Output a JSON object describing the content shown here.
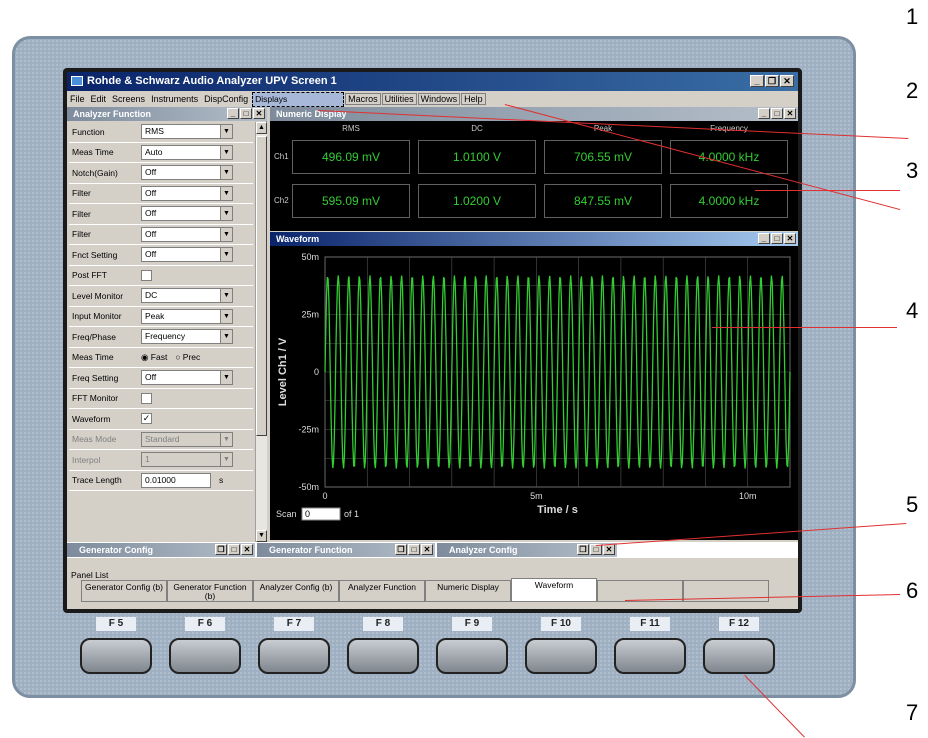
{
  "window": {
    "title": "Rohde & Schwarz Audio Analyzer UPV Screen 1"
  },
  "menu": [
    "File",
    "Edit",
    "Screens",
    "Instruments",
    "DispConfig",
    "Displays",
    "Macros",
    "Utilities",
    "Windows",
    "Help"
  ],
  "analyzer_function": {
    "title": "Analyzer Function",
    "rows": [
      {
        "label": "Function",
        "type": "select",
        "value": "RMS"
      },
      {
        "label": "Meas Time",
        "type": "select",
        "value": "Auto"
      },
      {
        "label": "Notch(Gain)",
        "type": "select",
        "value": "Off"
      },
      {
        "label": "Filter",
        "type": "select",
        "value": "Off"
      },
      {
        "label": "Filter",
        "type": "select",
        "value": "Off"
      },
      {
        "label": "Filter",
        "type": "select",
        "value": "Off"
      },
      {
        "label": "Fnct Setting",
        "type": "select",
        "value": "Off"
      },
      {
        "label": "Post FFT",
        "type": "check",
        "value": ""
      },
      {
        "label": "Level Monitor",
        "type": "select",
        "value": "DC"
      },
      {
        "label": "Input Monitor",
        "type": "select",
        "value": "Peak"
      },
      {
        "label": "Freq/Phase",
        "type": "select",
        "value": "Frequency"
      },
      {
        "label": "Meas Time",
        "type": "radio",
        "value": "Fast",
        "alt": "Prec"
      },
      {
        "label": "Freq Setting",
        "type": "select",
        "value": "Off"
      },
      {
        "label": "FFT Monitor",
        "type": "check",
        "value": ""
      },
      {
        "label": "Waveform",
        "type": "check",
        "value": "✓"
      },
      {
        "label": "Meas Mode",
        "type": "select",
        "value": "Standard",
        "disabled": true
      },
      {
        "label": "Interpol",
        "type": "select",
        "value": "1",
        "disabled": true
      },
      {
        "label": "Trace Length",
        "type": "text",
        "value": "0.01000",
        "unit": "s"
      }
    ]
  },
  "numeric_display": {
    "title": "Numeric Display",
    "columns": [
      "RMS",
      "DC",
      "Peak",
      "Frequency"
    ],
    "rows": [
      {
        "channel": "Ch1",
        "values": [
          "496.09 mV",
          "1.0100 V",
          "706.55 mV",
          "4.0000 kHz"
        ]
      },
      {
        "channel": "Ch2",
        "values": [
          "595.09 mV",
          "1.0200 V",
          "847.55 mV",
          "4.0000 kHz"
        ]
      }
    ]
  },
  "waveform": {
    "title": "Waveform",
    "scan_label": "Scan",
    "scan_value": "0",
    "scan_of": "of 1"
  },
  "chart_data": {
    "type": "line",
    "xlabel": "Time / s",
    "ylabel": "Level Ch1 / V",
    "xticks": [
      "0",
      "5m",
      "10m"
    ],
    "yticks": [
      "50m",
      "25m",
      "0",
      "-25m",
      "-50m"
    ],
    "xlim": [
      0,
      0.011
    ],
    "ylim": [
      -0.05,
      0.05
    ],
    "series": [
      {
        "waveform": "sine",
        "amplitude": 0.042,
        "frequency_hz": 4000,
        "color": "#33cc33"
      }
    ],
    "grid": true
  },
  "bottom_panels": [
    {
      "label": "Generator Config"
    },
    {
      "label": "Generator Function"
    },
    {
      "label": "Analyzer Config"
    }
  ],
  "panel_list": {
    "label": "Panel List",
    "softkeys": [
      "Generator Config (b)",
      "Generator Function (b)",
      "Analyzer Config (b)",
      "Analyzer Function",
      "Numeric Display",
      "Waveform",
      "",
      ""
    ]
  },
  "function_keys": [
    "F 5",
    "F 6",
    "F 7",
    "F 8",
    "F 9",
    "F 10",
    "F 11",
    "F 12"
  ],
  "callouts": [
    "1",
    "2",
    "3",
    "4",
    "5",
    "6",
    "7"
  ]
}
